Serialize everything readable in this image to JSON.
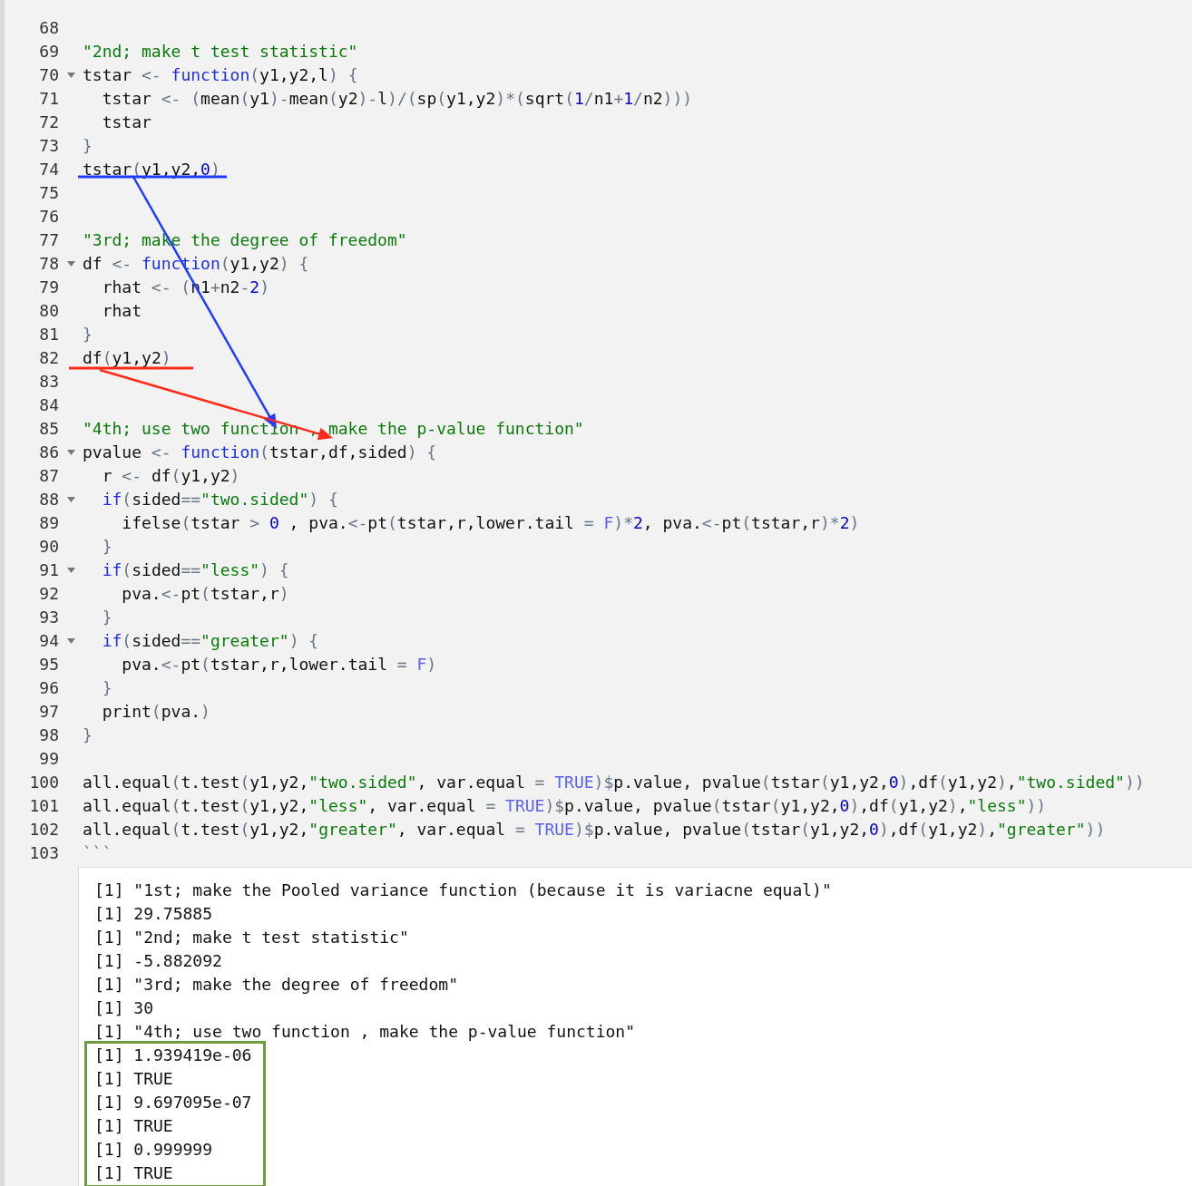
{
  "editor": {
    "lines": [
      {
        "number": "68",
        "fold": false
      },
      {
        "number": "69",
        "fold": false,
        "tokens": [
          {
            "kind": "string",
            "text": "\"2nd; make t test statistic\""
          }
        ]
      },
      {
        "number": "70",
        "fold": true,
        "tokens": [
          {
            "kind": "plain",
            "text": "tstar "
          },
          {
            "kind": "operator",
            "text": "<- "
          },
          {
            "kind": "keyword",
            "text": "function"
          },
          {
            "kind": "operator",
            "text": "("
          },
          {
            "kind": "plain",
            "text": "y1,y2,l"
          },
          {
            "kind": "operator",
            "text": ") {"
          }
        ]
      },
      {
        "number": "71",
        "fold": false,
        "tokens": [
          {
            "kind": "plain",
            "text": "  tstar "
          },
          {
            "kind": "operator",
            "text": "<- ("
          },
          {
            "kind": "plain",
            "text": "mean"
          },
          {
            "kind": "operator",
            "text": "("
          },
          {
            "kind": "plain",
            "text": "y1"
          },
          {
            "kind": "operator",
            "text": ")-"
          },
          {
            "kind": "plain",
            "text": "mean"
          },
          {
            "kind": "operator",
            "text": "("
          },
          {
            "kind": "plain",
            "text": "y2"
          },
          {
            "kind": "operator",
            "text": ")-"
          },
          {
            "kind": "plain",
            "text": "l"
          },
          {
            "kind": "operator",
            "text": ")/("
          },
          {
            "kind": "plain",
            "text": "sp"
          },
          {
            "kind": "operator",
            "text": "("
          },
          {
            "kind": "plain",
            "text": "y1,y2"
          },
          {
            "kind": "operator",
            "text": ")*("
          },
          {
            "kind": "plain",
            "text": "sqrt"
          },
          {
            "kind": "operator",
            "text": "("
          },
          {
            "kind": "number",
            "text": "1"
          },
          {
            "kind": "operator",
            "text": "/"
          },
          {
            "kind": "plain",
            "text": "n1"
          },
          {
            "kind": "operator",
            "text": "+"
          },
          {
            "kind": "number",
            "text": "1"
          },
          {
            "kind": "operator",
            "text": "/"
          },
          {
            "kind": "plain",
            "text": "n2"
          },
          {
            "kind": "operator",
            "text": ")))"
          }
        ]
      },
      {
        "number": "72",
        "fold": false,
        "tokens": [
          {
            "kind": "plain",
            "text": "  tstar"
          }
        ]
      },
      {
        "number": "73",
        "fold": false,
        "tokens": [
          {
            "kind": "operator",
            "text": "}"
          }
        ]
      },
      {
        "number": "74",
        "fold": false,
        "tokens": [
          {
            "kind": "plain",
            "text": "tstar"
          },
          {
            "kind": "operator",
            "text": "("
          },
          {
            "kind": "plain",
            "text": "y1,y2,"
          },
          {
            "kind": "number",
            "text": "0"
          },
          {
            "kind": "operator",
            "text": ")"
          }
        ]
      },
      {
        "number": "75",
        "fold": false
      },
      {
        "number": "76",
        "fold": false
      },
      {
        "number": "77",
        "fold": false,
        "tokens": [
          {
            "kind": "string",
            "text": "\"3rd; make the degree of freedom\""
          }
        ]
      },
      {
        "number": "78",
        "fold": true,
        "tokens": [
          {
            "kind": "plain",
            "text": "df "
          },
          {
            "kind": "operator",
            "text": "<- "
          },
          {
            "kind": "keyword",
            "text": "function"
          },
          {
            "kind": "operator",
            "text": "("
          },
          {
            "kind": "plain",
            "text": "y1,y2"
          },
          {
            "kind": "operator",
            "text": ") {"
          }
        ]
      },
      {
        "number": "79",
        "fold": false,
        "tokens": [
          {
            "kind": "plain",
            "text": "  rhat "
          },
          {
            "kind": "operator",
            "text": "<- ("
          },
          {
            "kind": "plain",
            "text": "n1"
          },
          {
            "kind": "operator",
            "text": "+"
          },
          {
            "kind": "plain",
            "text": "n2"
          },
          {
            "kind": "operator",
            "text": "-"
          },
          {
            "kind": "number",
            "text": "2"
          },
          {
            "kind": "operator",
            "text": ")"
          }
        ]
      },
      {
        "number": "80",
        "fold": false,
        "tokens": [
          {
            "kind": "plain",
            "text": "  rhat"
          }
        ]
      },
      {
        "number": "81",
        "fold": false,
        "tokens": [
          {
            "kind": "operator",
            "text": "}"
          }
        ]
      },
      {
        "number": "82",
        "fold": false,
        "tokens": [
          {
            "kind": "plain",
            "text": "df"
          },
          {
            "kind": "operator",
            "text": "("
          },
          {
            "kind": "plain",
            "text": "y1,y2"
          },
          {
            "kind": "operator",
            "text": ")"
          }
        ]
      },
      {
        "number": "83",
        "fold": false
      },
      {
        "number": "84",
        "fold": false
      },
      {
        "number": "85",
        "fold": false,
        "tokens": [
          {
            "kind": "string",
            "text": "\"4th; use two function , make the p-value function\""
          }
        ]
      },
      {
        "number": "86",
        "fold": true,
        "tokens": [
          {
            "kind": "plain",
            "text": "pvalue "
          },
          {
            "kind": "operator",
            "text": "<- "
          },
          {
            "kind": "keyword",
            "text": "function"
          },
          {
            "kind": "operator",
            "text": "("
          },
          {
            "kind": "plain",
            "text": "tstar,df,sided"
          },
          {
            "kind": "operator",
            "text": ") {"
          }
        ]
      },
      {
        "number": "87",
        "fold": false,
        "tokens": [
          {
            "kind": "plain",
            "text": "  r "
          },
          {
            "kind": "operator",
            "text": "<- "
          },
          {
            "kind": "plain",
            "text": "df"
          },
          {
            "kind": "operator",
            "text": "("
          },
          {
            "kind": "plain",
            "text": "y1,y2"
          },
          {
            "kind": "operator",
            "text": ")"
          }
        ]
      },
      {
        "number": "88",
        "fold": true,
        "tokens": [
          {
            "kind": "keyword",
            "text": "  if"
          },
          {
            "kind": "operator",
            "text": "("
          },
          {
            "kind": "plain",
            "text": "sided"
          },
          {
            "kind": "operator",
            "text": "=="
          },
          {
            "kind": "string",
            "text": "\"two.sided\""
          },
          {
            "kind": "operator",
            "text": ") {"
          }
        ]
      },
      {
        "number": "89",
        "fold": false,
        "tokens": [
          {
            "kind": "plain",
            "text": "    ifelse"
          },
          {
            "kind": "operator",
            "text": "("
          },
          {
            "kind": "plain",
            "text": "tstar "
          },
          {
            "kind": "operator",
            "text": "> "
          },
          {
            "kind": "number",
            "text": "0"
          },
          {
            "kind": "plain",
            "text": " , pva."
          },
          {
            "kind": "operator",
            "text": "<-"
          },
          {
            "kind": "plain",
            "text": "pt"
          },
          {
            "kind": "operator",
            "text": "("
          },
          {
            "kind": "plain",
            "text": "tstar,r,lower.tail "
          },
          {
            "kind": "operator",
            "text": "= "
          },
          {
            "kind": "constant",
            "text": "F"
          },
          {
            "kind": "operator",
            "text": ")*"
          },
          {
            "kind": "number",
            "text": "2"
          },
          {
            "kind": "plain",
            "text": ", pva."
          },
          {
            "kind": "operator",
            "text": "<-"
          },
          {
            "kind": "plain",
            "text": "pt"
          },
          {
            "kind": "operator",
            "text": "("
          },
          {
            "kind": "plain",
            "text": "tstar,r"
          },
          {
            "kind": "operator",
            "text": ")*"
          },
          {
            "kind": "number",
            "text": "2"
          },
          {
            "kind": "operator",
            "text": ")"
          }
        ]
      },
      {
        "number": "90",
        "fold": false,
        "tokens": [
          {
            "kind": "operator",
            "text": "  }"
          }
        ]
      },
      {
        "number": "91",
        "fold": true,
        "tokens": [
          {
            "kind": "keyword",
            "text": "  if"
          },
          {
            "kind": "operator",
            "text": "("
          },
          {
            "kind": "plain",
            "text": "sided"
          },
          {
            "kind": "operator",
            "text": "=="
          },
          {
            "kind": "string",
            "text": "\"less\""
          },
          {
            "kind": "operator",
            "text": ") {"
          }
        ]
      },
      {
        "number": "92",
        "fold": false,
        "tokens": [
          {
            "kind": "plain",
            "text": "    pva."
          },
          {
            "kind": "operator",
            "text": "<-"
          },
          {
            "kind": "plain",
            "text": "pt"
          },
          {
            "kind": "operator",
            "text": "("
          },
          {
            "kind": "plain",
            "text": "tstar,r"
          },
          {
            "kind": "operator",
            "text": ")"
          }
        ]
      },
      {
        "number": "93",
        "fold": false,
        "tokens": [
          {
            "kind": "operator",
            "text": "  }"
          }
        ]
      },
      {
        "number": "94",
        "fold": true,
        "tokens": [
          {
            "kind": "keyword",
            "text": "  if"
          },
          {
            "kind": "operator",
            "text": "("
          },
          {
            "kind": "plain",
            "text": "sided"
          },
          {
            "kind": "operator",
            "text": "=="
          },
          {
            "kind": "string",
            "text": "\"greater\""
          },
          {
            "kind": "operator",
            "text": ") {"
          }
        ]
      },
      {
        "number": "95",
        "fold": false,
        "tokens": [
          {
            "kind": "plain",
            "text": "    pva."
          },
          {
            "kind": "operator",
            "text": "<-"
          },
          {
            "kind": "plain",
            "text": "pt"
          },
          {
            "kind": "operator",
            "text": "("
          },
          {
            "kind": "plain",
            "text": "tstar,r,lower.tail "
          },
          {
            "kind": "operator",
            "text": "= "
          },
          {
            "kind": "constant",
            "text": "F"
          },
          {
            "kind": "operator",
            "text": ")"
          }
        ]
      },
      {
        "number": "96",
        "fold": false,
        "tokens": [
          {
            "kind": "operator",
            "text": "  }"
          }
        ]
      },
      {
        "number": "97",
        "fold": false,
        "tokens": [
          {
            "kind": "plain",
            "text": "  print"
          },
          {
            "kind": "operator",
            "text": "("
          },
          {
            "kind": "plain",
            "text": "pva."
          },
          {
            "kind": "operator",
            "text": ")"
          }
        ]
      },
      {
        "number": "98",
        "fold": false,
        "tokens": [
          {
            "kind": "operator",
            "text": "}"
          }
        ]
      },
      {
        "number": "99",
        "fold": false
      },
      {
        "number": "100",
        "fold": false,
        "tokens": [
          {
            "kind": "plain",
            "text": "all.equal"
          },
          {
            "kind": "operator",
            "text": "("
          },
          {
            "kind": "plain",
            "text": "t.test"
          },
          {
            "kind": "operator",
            "text": "("
          },
          {
            "kind": "plain",
            "text": "y1,y2,"
          },
          {
            "kind": "string",
            "text": "\"two.sided\""
          },
          {
            "kind": "plain",
            "text": ", var.equal "
          },
          {
            "kind": "operator",
            "text": "= "
          },
          {
            "kind": "constant",
            "text": "TRUE"
          },
          {
            "kind": "operator",
            "text": ")$"
          },
          {
            "kind": "plain",
            "text": "p.value, pvalue"
          },
          {
            "kind": "operator",
            "text": "("
          },
          {
            "kind": "plain",
            "text": "tstar"
          },
          {
            "kind": "operator",
            "text": "("
          },
          {
            "kind": "plain",
            "text": "y1,y2,"
          },
          {
            "kind": "number",
            "text": "0"
          },
          {
            "kind": "operator",
            "text": ")"
          },
          {
            "kind": "plain",
            "text": ",df"
          },
          {
            "kind": "operator",
            "text": "("
          },
          {
            "kind": "plain",
            "text": "y1,y2"
          },
          {
            "kind": "operator",
            "text": ")"
          },
          {
            "kind": "plain",
            "text": ","
          },
          {
            "kind": "string",
            "text": "\"two.sided\""
          },
          {
            "kind": "operator",
            "text": "))"
          }
        ]
      },
      {
        "number": "101",
        "fold": false,
        "tokens": [
          {
            "kind": "plain",
            "text": "all.equal"
          },
          {
            "kind": "operator",
            "text": "("
          },
          {
            "kind": "plain",
            "text": "t.test"
          },
          {
            "kind": "operator",
            "text": "("
          },
          {
            "kind": "plain",
            "text": "y1,y2,"
          },
          {
            "kind": "string",
            "text": "\"less\""
          },
          {
            "kind": "plain",
            "text": ", var.equal "
          },
          {
            "kind": "operator",
            "text": "= "
          },
          {
            "kind": "constant",
            "text": "TRUE"
          },
          {
            "kind": "operator",
            "text": ")$"
          },
          {
            "kind": "plain",
            "text": "p.value, pvalue"
          },
          {
            "kind": "operator",
            "text": "("
          },
          {
            "kind": "plain",
            "text": "tstar"
          },
          {
            "kind": "operator",
            "text": "("
          },
          {
            "kind": "plain",
            "text": "y1,y2,"
          },
          {
            "kind": "number",
            "text": "0"
          },
          {
            "kind": "operator",
            "text": ")"
          },
          {
            "kind": "plain",
            "text": ",df"
          },
          {
            "kind": "operator",
            "text": "("
          },
          {
            "kind": "plain",
            "text": "y1,y2"
          },
          {
            "kind": "operator",
            "text": ")"
          },
          {
            "kind": "plain",
            "text": ","
          },
          {
            "kind": "string",
            "text": "\"less\""
          },
          {
            "kind": "operator",
            "text": "))"
          }
        ]
      },
      {
        "number": "102",
        "fold": false,
        "tokens": [
          {
            "kind": "plain",
            "text": "all.equal"
          },
          {
            "kind": "operator",
            "text": "("
          },
          {
            "kind": "plain",
            "text": "t.test"
          },
          {
            "kind": "operator",
            "text": "("
          },
          {
            "kind": "plain",
            "text": "y1,y2,"
          },
          {
            "kind": "string",
            "text": "\"greater\""
          },
          {
            "kind": "plain",
            "text": ", var.equal "
          },
          {
            "kind": "operator",
            "text": "= "
          },
          {
            "kind": "constant",
            "text": "TRUE"
          },
          {
            "kind": "operator",
            "text": ")$"
          },
          {
            "kind": "plain",
            "text": "p.value, pvalue"
          },
          {
            "kind": "operator",
            "text": "("
          },
          {
            "kind": "plain",
            "text": "tstar"
          },
          {
            "kind": "operator",
            "text": "("
          },
          {
            "kind": "plain",
            "text": "y1,y2,"
          },
          {
            "kind": "number",
            "text": "0"
          },
          {
            "kind": "operator",
            "text": ")"
          },
          {
            "kind": "plain",
            "text": ",df"
          },
          {
            "kind": "operator",
            "text": "("
          },
          {
            "kind": "plain",
            "text": "y1,y2"
          },
          {
            "kind": "operator",
            "text": ")"
          },
          {
            "kind": "plain",
            "text": ","
          },
          {
            "kind": "string",
            "text": "\"greater\""
          },
          {
            "kind": "operator",
            "text": "))"
          }
        ]
      },
      {
        "number": "103",
        "fold": false,
        "tokens": [
          {
            "kind": "operator",
            "text": "```"
          }
        ]
      }
    ]
  },
  "output": {
    "lines": [
      "[1] \"1st; make the Pooled variance function (because it is variacne equal)\"",
      "[1] 29.75885",
      "[1] \"2nd; make t test statistic\"",
      "[1] -5.882092",
      "[1] \"3rd; make the degree of freedom\"",
      "[1] 30",
      "[1] \"4th; use two function , make the p-value function\""
    ],
    "boxed": {
      "color": "#6e9b3c",
      "lines": [
        "[1] 1.939419e-06",
        "[1] TRUE",
        "[1] 9.697095e-07",
        "[1] TRUE",
        "[1] 0.999999",
        "[1] TRUE"
      ]
    }
  },
  "annotations": [
    {
      "kind": "underline",
      "color": "#1f3cff"
    },
    {
      "kind": "arrow",
      "color": "#1f3cff"
    },
    {
      "kind": "underline",
      "color": "#ff2a1a"
    },
    {
      "kind": "arrow",
      "color": "#ff2a1a"
    }
  ]
}
